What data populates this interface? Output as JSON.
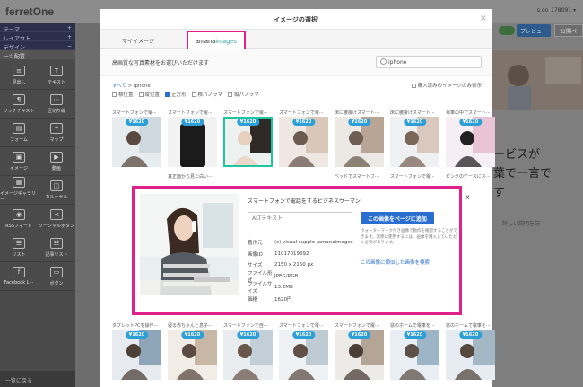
{
  "app": {
    "logo": "ferretOne",
    "topbar_right": "s.oo_178091 ▾",
    "preview_button": "プレビュー",
    "publish_button": "公開ペ",
    "bg_heading": "ービスが\n葉で一言で\nす",
    "bg_link": "詳しい説明を記"
  },
  "sidebar": {
    "headers": [
      {
        "label": "テーマ",
        "sign": "+"
      },
      {
        "label": "レイアウト",
        "sign": "+"
      },
      {
        "label": "デザイン",
        "sign": "−"
      }
    ],
    "sub": "ーツ配置",
    "widgets": [
      {
        "label": "見出し",
        "icon": "heading-icon",
        "glyph": "≡"
      },
      {
        "label": "テキスト",
        "icon": "text-icon",
        "glyph": "T"
      },
      {
        "label": "リッチテキスト",
        "icon": "rich-text-icon",
        "glyph": "¶"
      },
      {
        "label": "区切り線",
        "icon": "divider-icon",
        "glyph": "⋯"
      },
      {
        "label": "フォーム",
        "icon": "form-icon",
        "glyph": "▤"
      },
      {
        "label": "マップ",
        "icon": "map-icon",
        "glyph": "⌖"
      },
      {
        "label": "イメージ",
        "icon": "image-icon",
        "glyph": "▣"
      },
      {
        "label": "動画",
        "icon": "video-icon",
        "glyph": "▶"
      },
      {
        "label": "イメージギャラリー",
        "icon": "gallery-icon",
        "glyph": "▦"
      },
      {
        "label": "カルーセル",
        "icon": "carousel-icon",
        "glyph": "◫"
      },
      {
        "label": "RSSフィード",
        "icon": "rss-icon",
        "glyph": "◉"
      },
      {
        "label": "ソーシャルボタン",
        "icon": "share-icon",
        "glyph": "⋖"
      },
      {
        "label": "リスト",
        "icon": "list-icon",
        "glyph": "☰"
      },
      {
        "label": "記事リスト",
        "icon": "article-list-icon",
        "glyph": "☷"
      },
      {
        "label": "Facebook L···",
        "icon": "facebook-icon",
        "glyph": "f"
      },
      {
        "label": "ボタン",
        "icon": "button-icon",
        "glyph": "▭"
      }
    ],
    "footer": "一覧に戻る"
  },
  "modal": {
    "title": "イメージの選択",
    "close": "×",
    "tab_mine": "マイイメージ",
    "tab_amana_a": "amana",
    "tab_amana_b": "images",
    "subtitle": "高画質な写真素材をお選びいただけます",
    "search_value": "iphone",
    "crumb_all": "すべて",
    "crumb_current": "iphone",
    "purchased_label": "購入済みのイメージのみ表示",
    "shapes": [
      {
        "label": "横位置",
        "checked": false
      },
      {
        "label": "縦位置",
        "checked": false
      },
      {
        "label": "正方形",
        "checked": true
      },
      {
        "label": "横パノラマ",
        "checked": false
      },
      {
        "label": "縦パノラマ",
        "checked": false
      }
    ],
    "row1": [
      {
        "caption": "スマートフォンで電···",
        "price": "¥1620",
        "selected": false,
        "bottom_caption": ""
      },
      {
        "caption": "スマートフォンで電···",
        "price": "¥1620",
        "selected": false,
        "bottom_caption": "真正面から見た白い···"
      },
      {
        "caption": "スマートフォンで電···",
        "price": "¥1620",
        "selected": true,
        "bottom_caption": ""
      },
      {
        "caption": "スマートフォンで電···",
        "price": "¥1620",
        "selected": false,
        "bottom_caption": ""
      },
      {
        "caption": "床に腰掛けスマート···",
        "price": "¥1620",
        "selected": false,
        "bottom_caption": "ベッドでスマートフ···"
      },
      {
        "caption": "床に腰掛けスマート···",
        "price": "¥1620",
        "selected": false,
        "bottom_caption": "スマートフォンで電···"
      },
      {
        "caption": "電車の中でスマート···",
        "price": "¥1620",
        "selected": false,
        "bottom_caption": "ピンクのケースにス···"
      }
    ],
    "row2": [
      {
        "caption": "タブレットPCを操作···",
        "price": "¥1620"
      },
      {
        "caption": "寝る赤ちゃんと息子···",
        "price": "¥1620"
      },
      {
        "caption": "スマートフォンで自···",
        "price": "¥1620"
      },
      {
        "caption": "スマートフォンで電···",
        "price": "¥1620"
      },
      {
        "caption": "スマートフォンで電···",
        "price": "¥1620"
      },
      {
        "caption": "窓のホームで電車を···",
        "price": "¥1620"
      },
      {
        "caption": "窓のホームで電車を···",
        "price": "¥1620"
      }
    ]
  },
  "detail": {
    "title": "スマートフォンで電話をするビジネスウーマン",
    "alt_placeholder": "ALTテキスト",
    "add_button": "この画像をページに追加",
    "note": "ウォーターマーク付き画像で動作を確認することができます。実際に使用するには、画像を購入していただく必要があります。",
    "similar_link": "この画像に類似した画像を検索",
    "close": "x",
    "meta": [
      {
        "key": "著作元",
        "value": "(c) visual supple /amanaimages"
      },
      {
        "key": "画像ID",
        "value": "11017019692"
      },
      {
        "key": "サイズ",
        "value": "2150 x 2150 px"
      },
      {
        "key": "ファイル形式",
        "value": "JPEG/RGB"
      },
      {
        "key": "ファイルサイズ",
        "value": "13.2MB"
      },
      {
        "key": "価格",
        "value": "1620円"
      }
    ]
  },
  "colors": {
    "highlight": "#e0218a",
    "link": "#2a6fcf",
    "price_badge": "#2d9fd8",
    "selected": "#1fc4a0"
  }
}
